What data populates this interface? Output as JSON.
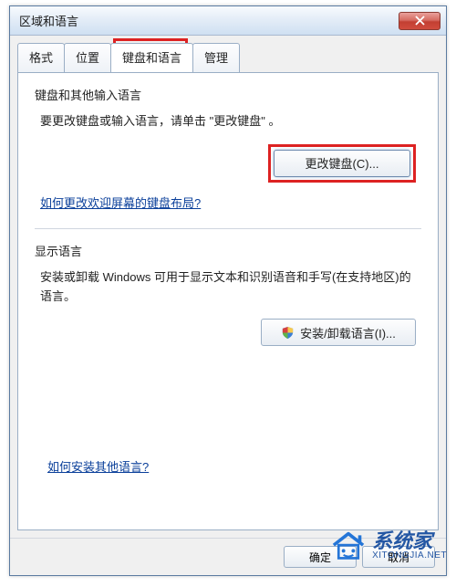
{
  "titlebar": {
    "title": "区域和语言"
  },
  "tabs": {
    "items": [
      {
        "label": "格式"
      },
      {
        "label": "位置"
      },
      {
        "label": "键盘和语言"
      },
      {
        "label": "管理"
      }
    ],
    "active_index": 2
  },
  "group1": {
    "title": "键盘和其他输入语言",
    "desc": "要更改键盘或输入语言，请单击 \"更改键盘\" 。",
    "change_keyboard_btn": "更改键盘(C)...",
    "welcome_link": "如何更改欢迎屏幕的键盘布局?"
  },
  "group2": {
    "title": "显示语言",
    "desc": "安装或卸载 Windows 可用于显示文本和识别语音和手写(在支持地区)的语言。",
    "install_btn": "安装/卸载语言(I)..."
  },
  "other_lang_link": "如何安装其他语言?",
  "footer": {
    "ok": "确定",
    "cancel": "取消"
  },
  "watermark": {
    "cn": "系统家",
    "en": "XITONGJIA.NET"
  }
}
